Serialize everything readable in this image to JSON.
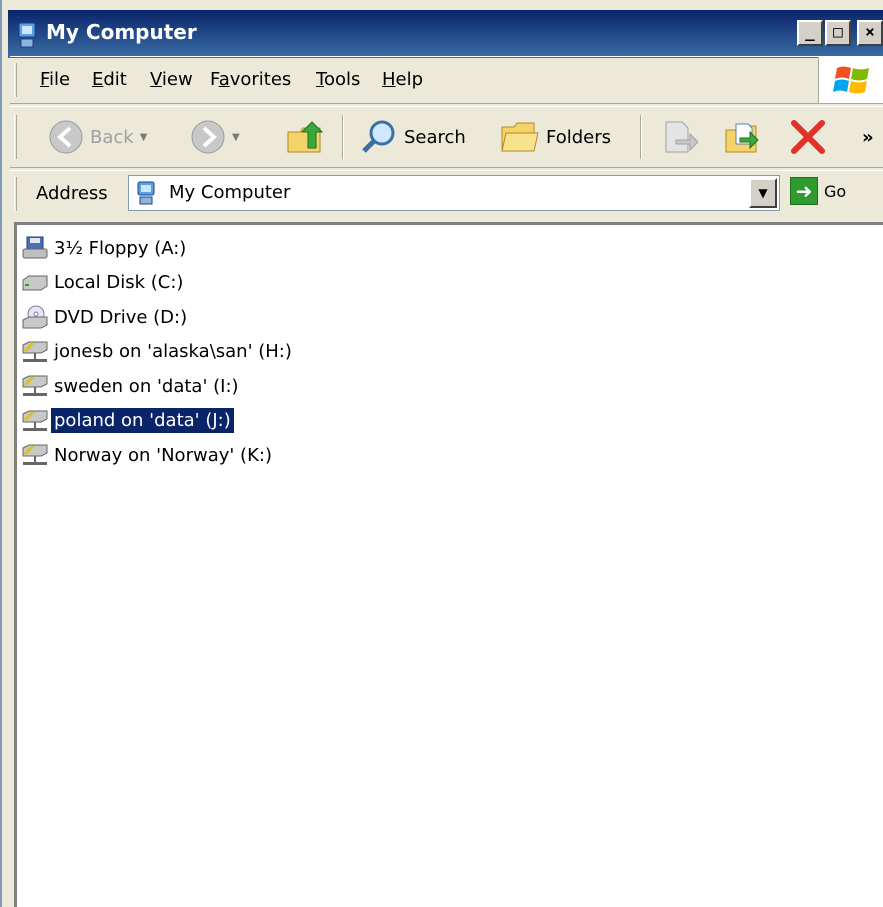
{
  "window": {
    "title": "My Computer",
    "controls": {
      "minimize": "_",
      "maximize": "□",
      "close": "×"
    }
  },
  "menu": [
    {
      "label": "File",
      "accel_index": 0
    },
    {
      "label": "Edit",
      "accel_index": 0
    },
    {
      "label": "View",
      "accel_index": 0
    },
    {
      "label": "Favorites",
      "accel_index": 1
    },
    {
      "label": "Tools",
      "accel_index": 0
    },
    {
      "label": "Help",
      "accel_index": 0
    }
  ],
  "toolbar": {
    "back_label": "Back",
    "search_label": "Search",
    "folders_label": "Folders",
    "more_label": "»"
  },
  "address": {
    "label": "Address",
    "value": "My Computer",
    "go_label": "Go"
  },
  "files": [
    {
      "label": "3½ Floppy (A:)",
      "icon": "floppy-drive-icon",
      "selected": false
    },
    {
      "label": "Local Disk (C:)",
      "icon": "hard-disk-icon",
      "selected": false
    },
    {
      "label": "DVD Drive (D:)",
      "icon": "dvd-drive-icon",
      "selected": false
    },
    {
      "label": "jonesb on 'alaska\\san' (H:)",
      "icon": "network-drive-icon",
      "selected": false
    },
    {
      "label": "sweden on 'data' (I:)",
      "icon": "network-drive-icon",
      "selected": false
    },
    {
      "label": "poland on 'data' (J:)",
      "icon": "network-drive-icon",
      "selected": true
    },
    {
      "label": "Norway on 'Norway' (K:)",
      "icon": "network-drive-icon",
      "selected": false
    }
  ],
  "colors": {
    "selection": "#0a246a",
    "titlebar": "#0a246a",
    "chrome": "#ece9d8"
  }
}
